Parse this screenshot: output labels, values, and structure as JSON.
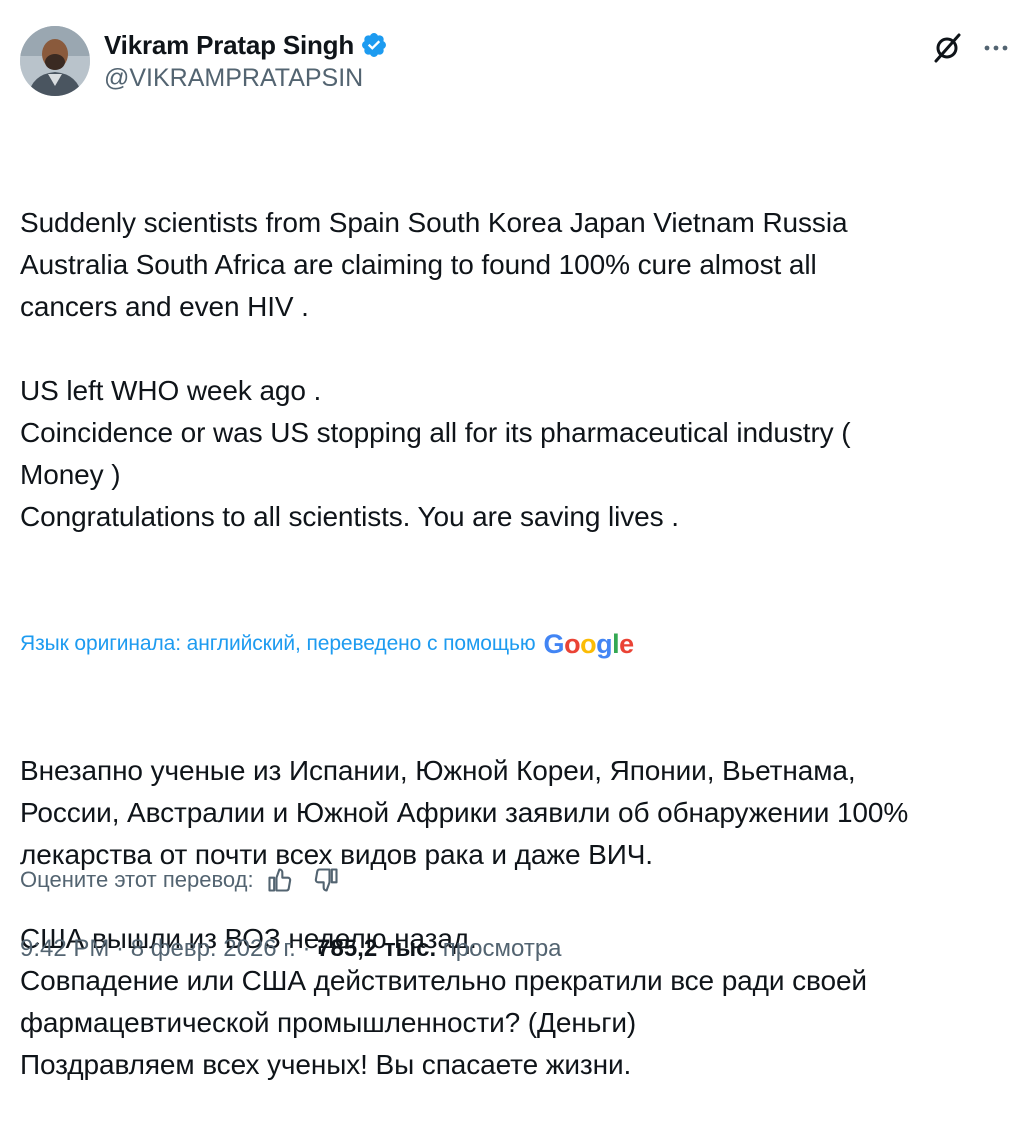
{
  "author": {
    "display_name": "Vikram Pratap Singh",
    "handle": "@VIKRAMPRATAPSIN",
    "verified": true,
    "avatar_icon": "user-avatar"
  },
  "header_actions": {
    "grok_icon": "grok-icon",
    "more_icon": "more-horizontal-icon"
  },
  "tweet": {
    "original_text": "Suddenly scientists from Spain South Korea Japan Vietnam Russia\nAustralia South Africa are claiming to found 100% cure almost all\ncancers and even HIV .\n\nUS left WHO week ago .\nCoincidence or was US stopping all for its pharmaceutical industry (\nMoney )\nCongratulations to all scientists. You are saving lives .",
    "translation_note": "Язык оригинала: английский, переведено с помощью",
    "translation_provider": {
      "g1": "G",
      "o1": "o",
      "o2": "o",
      "g2": "g",
      "l": "l",
      "e": "e"
    },
    "translated_text": "Внезапно ученые из Испании, Южной Кореи, Японии, Вьетнама,\nРоссии, Австралии и Южной Африки заявили об обнаружении 100%\nлекарства от почти всех видов рака и даже ВИЧ.\n\nСША вышли из ВОЗ неделю назад.\nСовпадение или США действительно прекратили все ради своей\nфармацевтической промышленности? (Деньги)\nПоздравляем всех ученых! Вы спасаете жизни."
  },
  "rating": {
    "label": "Оцените этот перевод:",
    "thumbs_up_icon": "thumbs-up-icon",
    "thumbs_down_icon": "thumbs-down-icon"
  },
  "meta": {
    "time": "9:42 PM",
    "separator": " · ",
    "date": "8 февр. 2026 г.",
    "views_count": "785,2 тыс.",
    "views_label": " просмотра"
  },
  "colors": {
    "text": "#0f1419",
    "secondary": "#536471",
    "link": "#1d9bf0",
    "verified": "#1d9bf0"
  }
}
